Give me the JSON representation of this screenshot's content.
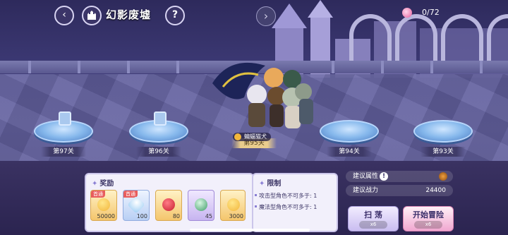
{
  "header": {
    "title": "幻影废墟",
    "help_label": "?",
    "back_symbol": "‹",
    "next_symbol": "›"
  },
  "progress": {
    "text": "0/72"
  },
  "stages": [
    {
      "label": "第97关",
      "locked": true
    },
    {
      "label": "第96关",
      "locked": true
    },
    {
      "label": "第95关",
      "locked": false,
      "current": true
    },
    {
      "label": "第94关",
      "locked": false
    },
    {
      "label": "第93关",
      "locked": false
    }
  ],
  "party": {
    "owner_name": "蝙蝠猫犬"
  },
  "rewards": {
    "title": "奖励",
    "items": [
      {
        "tag": "首通",
        "qty": "50000",
        "icon": "gold-coin-icon",
        "color": "#f2b63b",
        "style": ""
      },
      {
        "tag": "首通",
        "qty": "100",
        "icon": "diamond-icon",
        "color": "#bfe2ff",
        "style": "blue"
      },
      {
        "tag": "",
        "qty": "80",
        "icon": "red-rose-icon",
        "color": "#d93240",
        "style": ""
      },
      {
        "tag": "",
        "qty": "45",
        "icon": "flower-bouquet-icon",
        "color": "#5fbf86",
        "style": "purple"
      },
      {
        "tag": "",
        "qty": "3000",
        "icon": "gold-coin-icon",
        "color": "#f2b63b",
        "style": ""
      }
    ]
  },
  "limits": {
    "title": "限制",
    "rows": [
      "攻击型角色不可多于: 1",
      "魔法型角色不可多于: 1"
    ]
  },
  "info": {
    "attr_label": "建议属性",
    "power_label": "建议战力",
    "power_value": "24400"
  },
  "buttons": {
    "sweep_label": "扫 荡",
    "sweep_cost": "x6",
    "start_label": "开始冒险",
    "start_cost": "x6"
  },
  "colors": {
    "accent": "#8a7fd4",
    "panel": "#f2f0fb"
  }
}
